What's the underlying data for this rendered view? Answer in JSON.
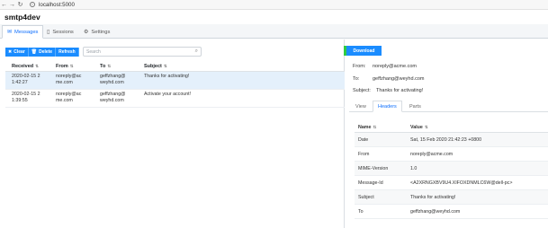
{
  "browser": {
    "url": "localhost:5000"
  },
  "app": {
    "title": "smtp4dev"
  },
  "tabs": [
    {
      "label": "Messages",
      "icon": "envelope-icon",
      "active": true
    },
    {
      "label": "Sessions",
      "icon": "sessions-icon",
      "active": false
    },
    {
      "label": "Settings",
      "icon": "gear-icon",
      "active": false
    }
  ],
  "toolbar": {
    "clear_label": "Clear",
    "delete_label": "Delete",
    "refresh_label": "Refresh",
    "search_placeholder": "Search"
  },
  "messages": {
    "columns": [
      "Received",
      "From",
      "To",
      "Subject"
    ],
    "rows": [
      {
        "received": "2020-02-15 2 1:42:27",
        "from": "noreply@ac me.com",
        "to": "geffzhang@ weyhd.com",
        "subject": "Thanks for activating!"
      },
      {
        "received": "2020-02-15 2 1:39:55",
        "from": "noreply@ac me.com",
        "to": "geffzhang@ weyhd.com",
        "subject": "Activate your account!"
      }
    ]
  },
  "preview": {
    "download_label": "Download",
    "from_key": "From:",
    "from": "noreply@acme.com",
    "to_key": "To:",
    "to": "geffzhang@weyhd.com",
    "subject_key": "Subject:",
    "subject": "Thanks for activating!",
    "subtabs": [
      "View",
      "Headers",
      "Parts"
    ],
    "headers_columns": [
      "Name",
      "Value"
    ],
    "headers": [
      {
        "name": "Date",
        "value": "Sat, 15 Feb 2020 21:42:23 +0800"
      },
      {
        "name": "From",
        "value": "noreply@acme.com"
      },
      {
        "name": "MIME-Version",
        "value": "1.0"
      },
      {
        "name": "Message-Id",
        "value": "<A2XRNGXBV9U4.XIFOXDNMLC6W@dell-pc>"
      },
      {
        "name": "Subject",
        "value": "Thanks for activating!"
      },
      {
        "name": "To",
        "value": "geffzhang@weyhd.com"
      }
    ]
  }
}
